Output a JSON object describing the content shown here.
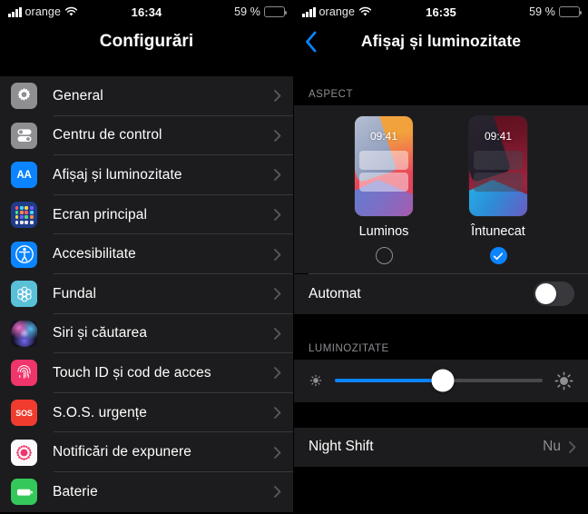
{
  "left": {
    "status": {
      "carrier": "orange",
      "time": "16:34",
      "battery_text": "59 %",
      "battery_level": 59
    },
    "nav": {
      "title": "Configurări"
    },
    "items": [
      {
        "label": "General",
        "icon": "gear-icon"
      },
      {
        "label": "Centru de control",
        "icon": "control-center-icon"
      },
      {
        "label": "Afișaj și luminozitate",
        "icon": "display-aa-icon"
      },
      {
        "label": "Ecran principal",
        "icon": "home-screen-icon"
      },
      {
        "label": "Accesibilitate",
        "icon": "accessibility-icon"
      },
      {
        "label": "Fundal",
        "icon": "wallpaper-icon"
      },
      {
        "label": "Siri și căutarea",
        "icon": "siri-icon"
      },
      {
        "label": "Touch ID și cod de acces",
        "icon": "touch-id-icon"
      },
      {
        "label": "S.O.S. urgențe",
        "icon": "sos-icon",
        "icon_text": "SOS"
      },
      {
        "label": "Notificări de expunere",
        "icon": "exposure-notification-icon"
      },
      {
        "label": "Baterie",
        "icon": "battery-icon"
      }
    ]
  },
  "right": {
    "status": {
      "carrier": "orange",
      "time": "16:35",
      "battery_text": "59 %",
      "battery_level": 59
    },
    "nav": {
      "title": "Afișaj și luminozitate",
      "back_icon": "back-chevron-icon"
    },
    "aspect": {
      "header": "ASPECT",
      "options": [
        {
          "label": "Luminos",
          "preview_time": "09:41",
          "selected": false
        },
        {
          "label": "Întunecat",
          "preview_time": "09:41",
          "selected": true
        }
      ],
      "auto": {
        "label": "Automat",
        "on": false
      }
    },
    "brightness": {
      "header": "LUMINOZITATE",
      "value": 52,
      "low_icon": "brightness-low-icon",
      "high_icon": "brightness-high-icon"
    },
    "night_shift": {
      "label": "Night Shift",
      "value": "Nu"
    }
  },
  "colors": {
    "accent": "#0a84ff",
    "row_bg": "#1c1c1e",
    "page_bg": "#000000",
    "separator": "#38383a",
    "secondary_text": "#8e8e93",
    "battery_yellow": "#fdd835"
  }
}
